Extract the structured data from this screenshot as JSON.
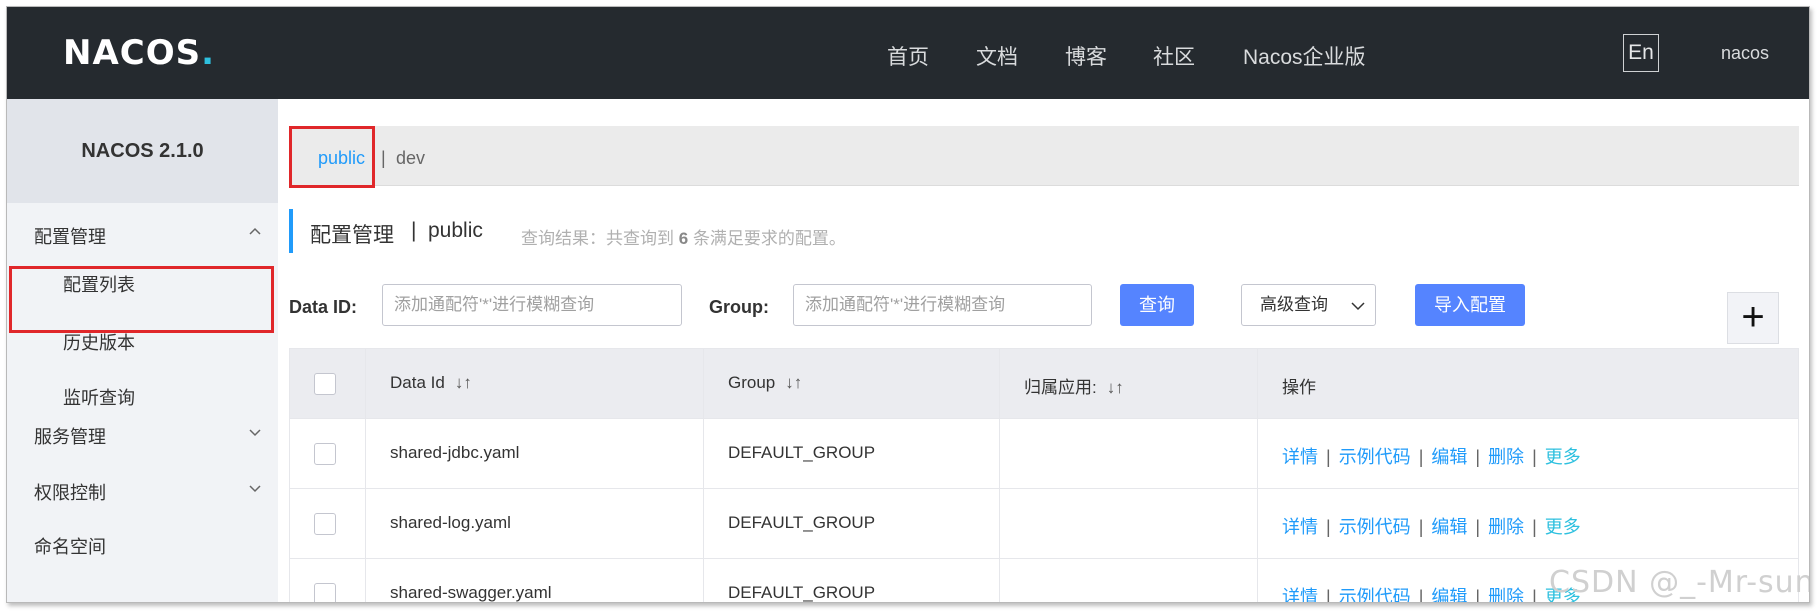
{
  "header": {
    "logo": "NACOS",
    "logo_dot": ".",
    "nav": [
      "首页",
      "文档",
      "博客",
      "社区",
      "Nacos企业版"
    ],
    "lang_button": "En",
    "user": "nacos"
  },
  "sidebar": {
    "version": "NACOS 2.1.0",
    "groups": [
      {
        "label": "配置管理",
        "expanded": true,
        "items": [
          "配置列表",
          "历史版本",
          "监听查询"
        ]
      },
      {
        "label": "服务管理",
        "expanded": false
      },
      {
        "label": "权限控制",
        "expanded": false
      },
      {
        "label": "命名空间"
      }
    ]
  },
  "namespaces": {
    "active": "public",
    "separator": "|",
    "others": [
      "dev"
    ]
  },
  "title": {
    "main": "配置管理",
    "separator": "|",
    "namespace": "public",
    "summary_prefix": "查询结果：共查询到",
    "count": "6",
    "summary_suffix": "条满足要求的配置。"
  },
  "search": {
    "data_id_label": "Data ID:",
    "data_id_placeholder": "添加通配符'*'进行模糊查询",
    "group_label": "Group:",
    "group_placeholder": "添加通配符'*'进行模糊查询",
    "query_button": "查询",
    "advanced_button": "高级查询",
    "import_button": "导入配置",
    "add_button": "+"
  },
  "table": {
    "columns": [
      "Data Id",
      "Group",
      "归属应用:",
      "操作"
    ],
    "rows": [
      {
        "data_id": "shared-jdbc.yaml",
        "group": "DEFAULT_GROUP",
        "app": ""
      },
      {
        "data_id": "shared-log.yaml",
        "group": "DEFAULT_GROUP",
        "app": ""
      },
      {
        "data_id": "shared-swagger.yaml",
        "group": "DEFAULT_GROUP",
        "app": ""
      }
    ],
    "actions": {
      "detail": "详情",
      "sample": "示例代码",
      "edit": "编辑",
      "delete": "删除",
      "more": "更多",
      "sep": "|"
    }
  },
  "watermark": "CSDN @_-Mr-sun",
  "colors": {
    "header_bg": "#252a2f",
    "primary": "#5584ff",
    "link": "#209bfa",
    "highlight_box": "#e0272a"
  }
}
